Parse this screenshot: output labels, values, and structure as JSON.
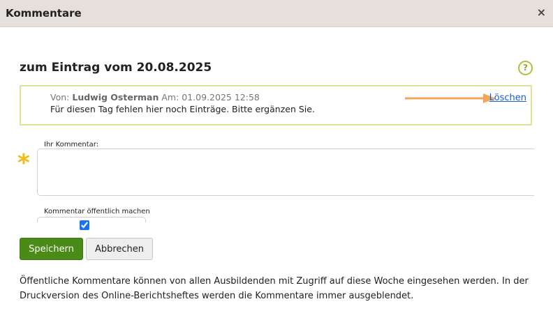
{
  "dialog": {
    "title": "Kommentare",
    "close_glyph": "×"
  },
  "heading": "zum Eintrag vom 20.08.2025",
  "help_glyph": "?",
  "comment": {
    "from_label": "Von:",
    "author": "Ludwig Osterman",
    "date_label": "Am:",
    "date": "01.09.2025 12:58",
    "text": "Für diesen Tag fehlen hier noch Einträge. Bitte ergänzen Sie.",
    "delete_label": "Löschen"
  },
  "form": {
    "comment_label": "Ihr Kommentar:",
    "comment_value": "",
    "required_mark": "*",
    "public_label": "Kommentar öffentlich machen",
    "public_checked": true
  },
  "buttons": {
    "save": "Speichern",
    "cancel": "Abbrechen"
  },
  "footnote": "Öffentliche Kommentare können von allen Ausbildenden mit Zugriff auf diese Woche eingesehen werden. In der Druckversion des Online-Berichtsheftes werden die Kommentare immer ausgeblendet.",
  "colors": {
    "accent_green": "#4a8a16",
    "required_star": "#f2bb18",
    "annotation_arrow": "#f2a65a",
    "link": "#1a5fd4"
  },
  "icons": {
    "close": "close-icon",
    "help": "help-icon",
    "arrow": "arrow-right-icon"
  }
}
